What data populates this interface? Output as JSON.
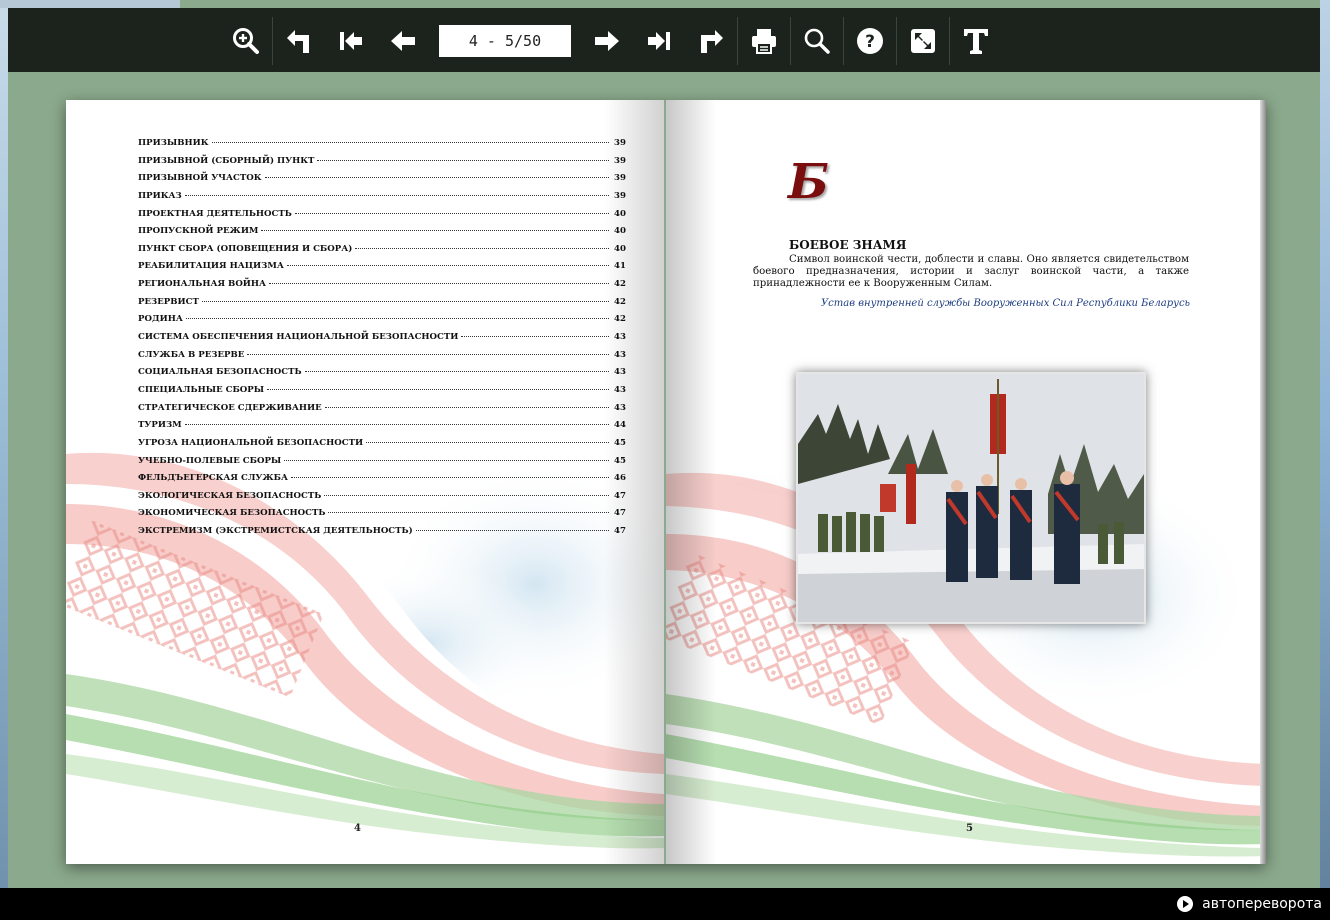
{
  "toolbar": {
    "page_indicator": "4 - 5/50",
    "tools_left": [
      "zoom-in-icon",
      "undo-icon",
      "first-page-icon",
      "prev-page-icon"
    ],
    "tools_right": [
      "next-page-icon",
      "last-page-icon",
      "redo-icon",
      "print-icon",
      "search-icon",
      "help-icon",
      "fullscreen-icon",
      "text-icon"
    ]
  },
  "left_page": {
    "toc": [
      {
        "title": "ПРИЗЫВНИК",
        "page": "39"
      },
      {
        "title": "ПРИЗЫВНОЙ (СБОРНЫЙ) ПУНКТ",
        "page": "39"
      },
      {
        "title": "ПРИЗЫВНОЙ УЧАСТОК",
        "page": "39"
      },
      {
        "title": "ПРИКАЗ",
        "page": "39"
      },
      {
        "title": "ПРОЕКТНАЯ ДЕЯТЕЛЬНОСТЬ",
        "page": "40"
      },
      {
        "title": "ПРОПУСКНОЙ РЕЖИМ",
        "page": "40"
      },
      {
        "title": "ПУНКТ СБОРА (ОПОВЕЩЕНИЯ И СБОРА)",
        "page": "40"
      },
      {
        "title": "РЕАБИЛИТАЦИЯ НАЦИЗМА",
        "page": "41"
      },
      {
        "title": "РЕГИОНАЛЬНАЯ ВОЙНА",
        "page": "42"
      },
      {
        "title": "РЕЗЕРВИСТ",
        "page": "42"
      },
      {
        "title": "РОДИНА",
        "page": "42"
      },
      {
        "title": "СИСТЕМА ОБЕСПЕЧЕНИЯ НАЦИОНАЛЬНОЙ БЕЗОПАСНОСТИ",
        "page": "43"
      },
      {
        "title": "СЛУЖБА В РЕЗЕРВЕ",
        "page": "43"
      },
      {
        "title": "СОЦИАЛЬНАЯ БЕЗОПАСНОСТЬ",
        "page": "43"
      },
      {
        "title": "СПЕЦИАЛЬНЫЕ СБОРЫ",
        "page": "43"
      },
      {
        "title": "СТРАТЕГИЧЕСКОЕ СДЕРЖИВАНИЕ",
        "page": "43"
      },
      {
        "title": "ТУРИЗМ",
        "page": "44"
      },
      {
        "title": "УГРОЗА НАЦИОНАЛЬНОЙ БЕЗОПАСНОСТИ",
        "page": "45"
      },
      {
        "title": "УЧЕБНО-ПОЛЕВЫЕ СБОРЫ",
        "page": "45"
      },
      {
        "title": "ФЕЛЬДЪЕГЕРСКАЯ СЛУЖБА",
        "page": "46"
      },
      {
        "title": "ЭКОЛОГИЧЕСКАЯ БЕЗОПАСНОСТЬ",
        "page": "47"
      },
      {
        "title": "ЭКОНОМИЧЕСКАЯ БЕЗОПАСНОСТЬ",
        "page": "47"
      },
      {
        "title": "ЭКСТРЕМИЗМ (ЭКСТРЕМИСТСКАЯ ДЕЯТЕЛЬНОСТЬ)",
        "page": "47"
      }
    ],
    "page_number": "4"
  },
  "right_page": {
    "letter": "Б",
    "entry_title": "БОЕВОЕ ЗНАМЯ",
    "entry_text": "Символ воинской чести, доблести и славы. Оно является свидетельством боевого предназначения, истории и заслуг воинской части, а также принадлежности ее к Вооруженным Силам.",
    "entry_source": "Устав внутренней службы Вооруженных Сил Республики Беларусь",
    "page_number": "5"
  },
  "statusbar": {
    "autoflip_label": "автопереворота"
  },
  "colors": {
    "frame": "#8ba98c",
    "toolbar": "#1c231c",
    "accent_red": "#d9473f",
    "accent_green": "#5aa64b",
    "letter": "#7a0e0e",
    "source": "#1d3d82"
  }
}
